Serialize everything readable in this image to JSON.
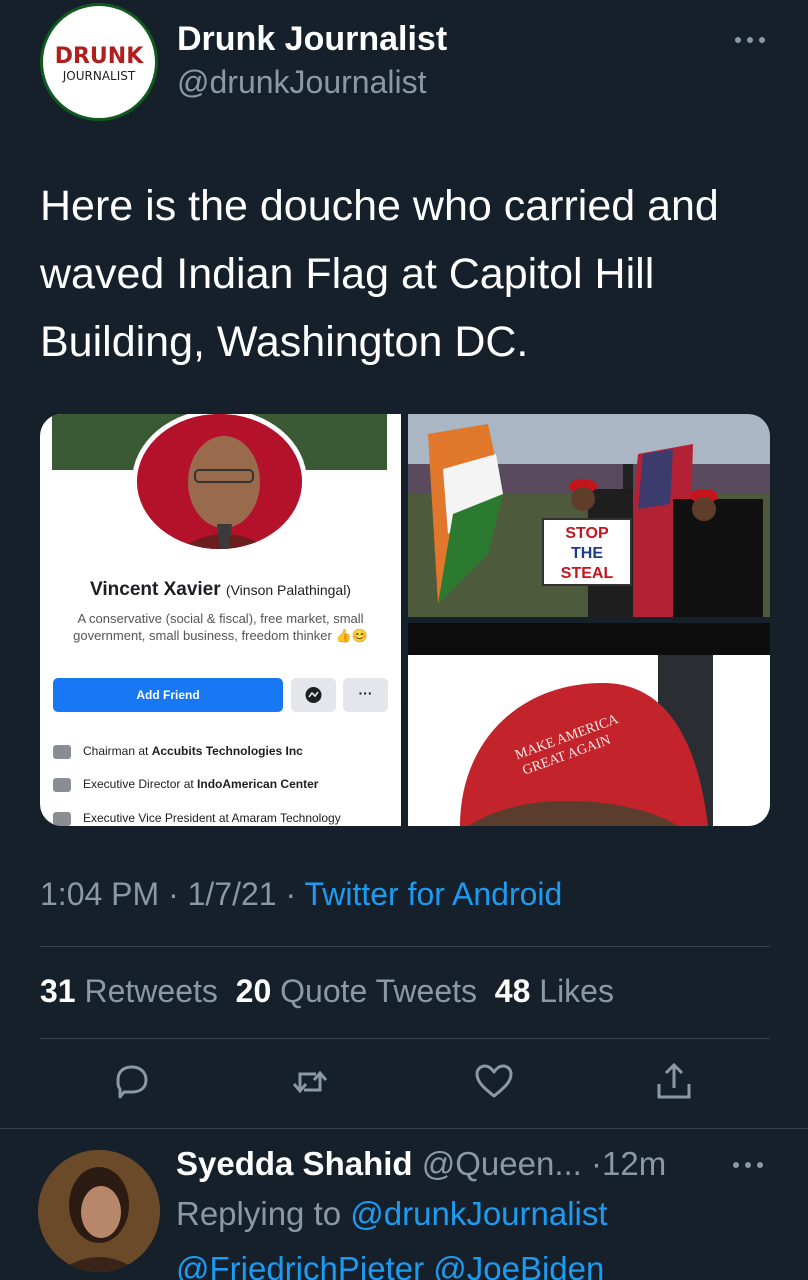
{
  "tweet": {
    "author": {
      "display_name": "Drunk Journalist",
      "handle": "@drunkJournalist",
      "avatar_logo_top": "DRUNK",
      "avatar_logo_bottom": "JOURNALIST"
    },
    "text": "Here is the douche who carried and waved Indian Flag at Capitol Hill Building, Washington DC.",
    "media": {
      "profile_card": {
        "name": "Vincent Xavier",
        "alt_name": "(Vinson Palathingal)",
        "bio": "A conservative (social & fiscal), free market, small government, small business, freedom thinker 👍😊",
        "add_friend": "Add Friend",
        "more": "···",
        "work": [
          {
            "role": "Chairman at ",
            "org": "Accubits Technologies Inc"
          },
          {
            "role": "Executive Director at ",
            "org": "IndoAmerican Center"
          },
          {
            "role": "Executive Vice President at Amaram Technology",
            "org": ""
          }
        ]
      },
      "rally_sign": [
        "STOP",
        "THE",
        "STEAL"
      ],
      "hat_text": [
        "MAKE AMERICA",
        "GREAT AGAIN"
      ]
    },
    "time": "1:04 PM",
    "date": "1/7/21",
    "dot": "·",
    "source": "Twitter for Android",
    "stats": {
      "retweets_count": "31",
      "retweets_label": "Retweets",
      "quotes_count": "20",
      "quotes_label": "Quote Tweets",
      "likes_count": "48",
      "likes_label": "Likes"
    },
    "actions": [
      "reply-icon",
      "retweet-icon",
      "like-icon",
      "share-icon"
    ],
    "colors": {
      "background": "#15202b",
      "accent": "#1d9bf0",
      "muted": "#8b98a5"
    }
  },
  "reply": {
    "display_name": "Syedda Shahid",
    "handle": "@Queen...",
    "time": "·12m",
    "replying_to_label": "Replying to",
    "replying_to_handle": "@drunkJournalist",
    "mentions": "@FriedrichPieter @JoeBiden"
  }
}
